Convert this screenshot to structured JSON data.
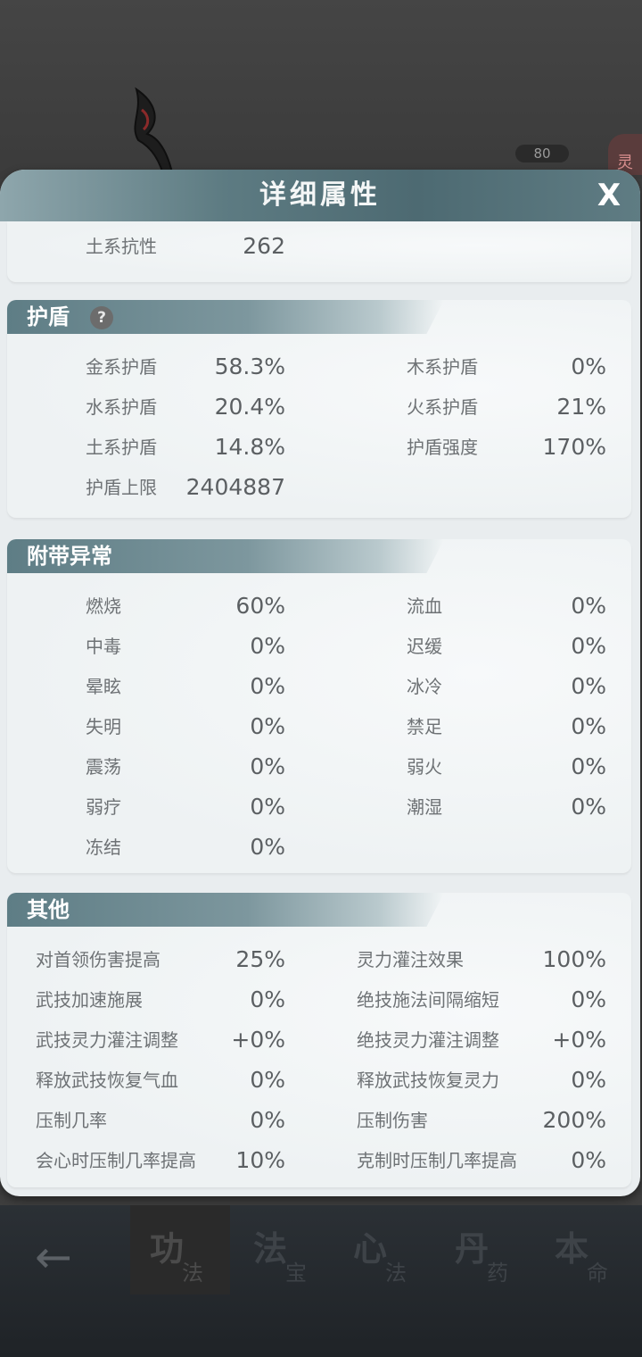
{
  "background": {
    "level": "80",
    "side_char": "灵"
  },
  "modal": {
    "title": "详细属性",
    "close_label": "X"
  },
  "resistance": {
    "rows": [
      {
        "label": "土系抗性",
        "value": "262"
      }
    ]
  },
  "shield": {
    "title": "护盾",
    "help": "?",
    "left": [
      {
        "label": "金系护盾",
        "value": "58.3%"
      },
      {
        "label": "水系护盾",
        "value": "20.4%"
      },
      {
        "label": "土系护盾",
        "value": "14.8%"
      },
      {
        "label": "护盾上限",
        "value": "2404887"
      }
    ],
    "right": [
      {
        "label": "木系护盾",
        "value": "0%"
      },
      {
        "label": "火系护盾",
        "value": "21%"
      },
      {
        "label": "护盾强度",
        "value": "170%"
      }
    ]
  },
  "abnormal": {
    "title": "附带异常",
    "left": [
      {
        "label": "燃烧",
        "value": "60%"
      },
      {
        "label": "中毒",
        "value": "0%"
      },
      {
        "label": "晕眩",
        "value": "0%"
      },
      {
        "label": "失明",
        "value": "0%"
      },
      {
        "label": "震荡",
        "value": "0%"
      },
      {
        "label": "弱疗",
        "value": "0%"
      },
      {
        "label": "冻结",
        "value": "0%"
      }
    ],
    "right": [
      {
        "label": "流血",
        "value": "0%"
      },
      {
        "label": "迟缓",
        "value": "0%"
      },
      {
        "label": "冰冷",
        "value": "0%"
      },
      {
        "label": "禁足",
        "value": "0%"
      },
      {
        "label": "弱火",
        "value": "0%"
      },
      {
        "label": "潮湿",
        "value": "0%"
      }
    ]
  },
  "other": {
    "title": "其他",
    "left": [
      {
        "label": "对首领伤害提高",
        "value": "25%"
      },
      {
        "label": "武技加速施展",
        "value": "0%"
      },
      {
        "label": "武技灵力灌注调整",
        "value": "+0%"
      },
      {
        "label": "释放武技恢复气血",
        "value": "0%"
      },
      {
        "label": "压制几率",
        "value": "0%"
      },
      {
        "label": "会心时压制几率提高",
        "value": "10%"
      }
    ],
    "right": [
      {
        "label": "灵力灌注效果",
        "value": "100%"
      },
      {
        "label": "绝技施法间隔缩短",
        "value": "0%"
      },
      {
        "label": "绝技灵力灌注调整",
        "value": "+0%"
      },
      {
        "label": "释放武技恢复灵力",
        "value": "0%"
      },
      {
        "label": "压制伤害",
        "value": "200%"
      },
      {
        "label": "克制时压制几率提高",
        "value": "0%"
      }
    ]
  },
  "nav": {
    "tabs": [
      {
        "big": "功",
        "small": "法"
      },
      {
        "big": "法",
        "small": "宝"
      },
      {
        "big": "心",
        "small": "法"
      },
      {
        "big": "丹",
        "small": "药"
      },
      {
        "big": "本",
        "small": "命"
      }
    ]
  }
}
